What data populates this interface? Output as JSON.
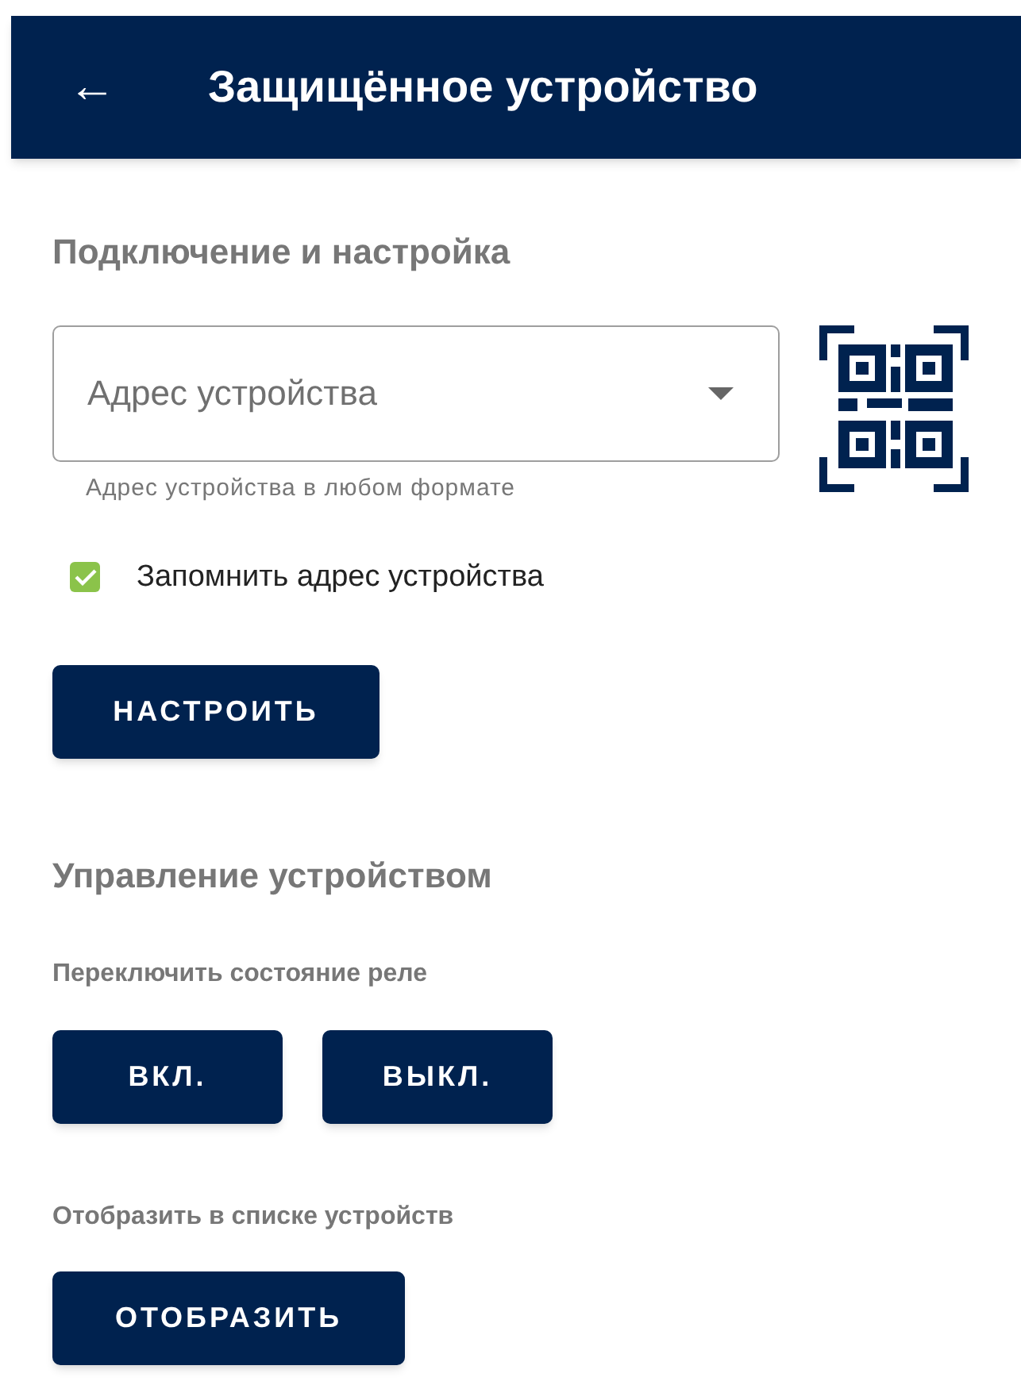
{
  "app_bar": {
    "back_icon": "←",
    "title": "Защищённое устройство"
  },
  "sections": [
    {
      "heading": "Подключение и настройка"
    },
    {
      "heading": "Управление устройством"
    }
  ],
  "address_field": {
    "placeholder": "Адрес устройства",
    "helper": "Адрес устройства в любом формате"
  },
  "remember_checkbox": {
    "label": "Запомнить адрес устройства",
    "checked": true
  },
  "setup_button": "НАСТРОИТЬ",
  "relay": {
    "label": "Переключить состояние реле",
    "buttons": [
      "ВКЛ.",
      "ВЫКЛ."
    ]
  },
  "display": {
    "label": "Отобразить в списке устройств",
    "button": "ОТОБРАЗИТЬ"
  }
}
